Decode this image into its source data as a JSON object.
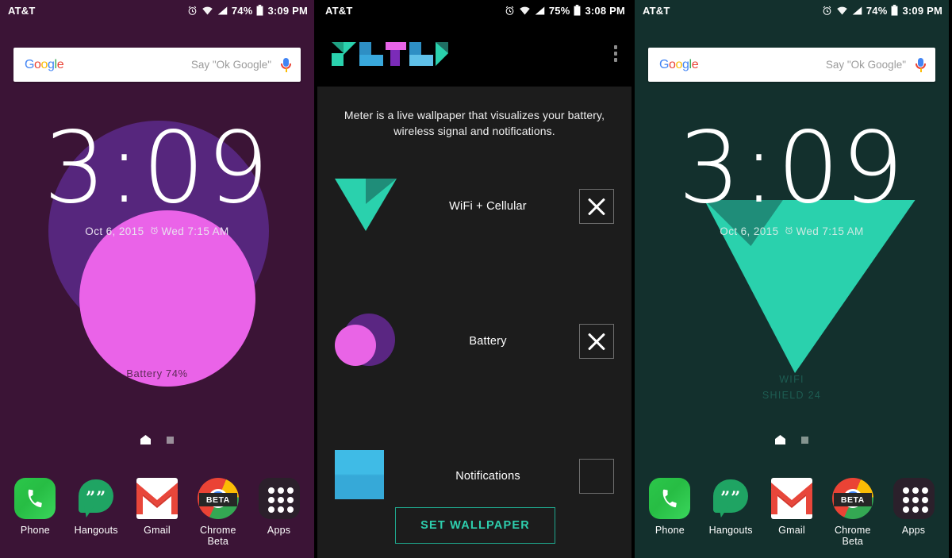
{
  "panels": [
    {
      "kind": "homescreen",
      "statusbar": {
        "carrier": "AT&T",
        "battery": "74%",
        "time": "3:09 PM",
        "icons": [
          "alarm-icon",
          "wifi-icon",
          "cellular-signal-icon",
          "battery-icon"
        ]
      },
      "search": {
        "logo": "Google",
        "hint": "Say \"Ok Google\"",
        "mic": "microphone-icon"
      },
      "clock": {
        "time": "3:09",
        "date": "Oct 6, 2015",
        "alarm": "Wed 7:15 AM"
      },
      "caption": "Battery 74%",
      "colors": {
        "background": "#3b1436",
        "ring": "#56267d",
        "fill": "#ea63e8"
      },
      "dock": [
        {
          "label": "Phone",
          "icon": "phone-icon"
        },
        {
          "label": "Hangouts",
          "icon": "hangouts-icon"
        },
        {
          "label": "Gmail",
          "icon": "gmail-icon"
        },
        {
          "label": "Chrome Beta",
          "icon": "chrome-icon",
          "badge": "BETA"
        },
        {
          "label": "Apps",
          "icon": "apps-grid-icon"
        }
      ]
    },
    {
      "kind": "app",
      "statusbar": {
        "carrier": "AT&T",
        "battery": "75%",
        "time": "3:08 PM",
        "icons": [
          "alarm-icon",
          "wifi-icon",
          "cellular-signal-icon",
          "battery-icon"
        ]
      },
      "app": {
        "logo_text": "METER",
        "overflow": "overflow-menu-icon",
        "description": "Meter is a live wallpaper that visualizes your battery, wireless signal and notifications.",
        "rows": [
          {
            "label": "WiFi + Cellular",
            "icon": "triangle-icon",
            "checked": true
          },
          {
            "label": "Battery",
            "icon": "circle-icon",
            "checked": true
          },
          {
            "label": "Notifications",
            "icon": "square-icon",
            "checked": false
          }
        ],
        "primary_button": "SET WALLPAPER"
      },
      "colors": {
        "background": "#1c1c1c",
        "appbar": "#000000",
        "accent": "#2ecfae"
      }
    },
    {
      "kind": "homescreen",
      "statusbar": {
        "carrier": "AT&T",
        "battery": "74%",
        "time": "3:09 PM",
        "icons": [
          "alarm-icon",
          "wifi-icon",
          "cellular-signal-icon",
          "battery-icon"
        ]
      },
      "search": {
        "logo": "Google",
        "hint": "Say \"Ok Google\"",
        "mic": "microphone-icon"
      },
      "clock": {
        "time": "3:09",
        "date": "Oct 6, 2015",
        "alarm": "Wed 7:15 AM"
      },
      "caption_line1": "WIFI",
      "caption_line2": "SHIELD 24",
      "colors": {
        "background": "#13302d",
        "fill": "#2ad1ad",
        "shade": "#1f8d79"
      },
      "dock": [
        {
          "label": "Phone",
          "icon": "phone-icon"
        },
        {
          "label": "Hangouts",
          "icon": "hangouts-icon"
        },
        {
          "label": "Gmail",
          "icon": "gmail-icon"
        },
        {
          "label": "Chrome Beta",
          "icon": "chrome-icon",
          "badge": "BETA"
        },
        {
          "label": "Apps",
          "icon": "apps-grid-icon"
        }
      ]
    }
  ]
}
